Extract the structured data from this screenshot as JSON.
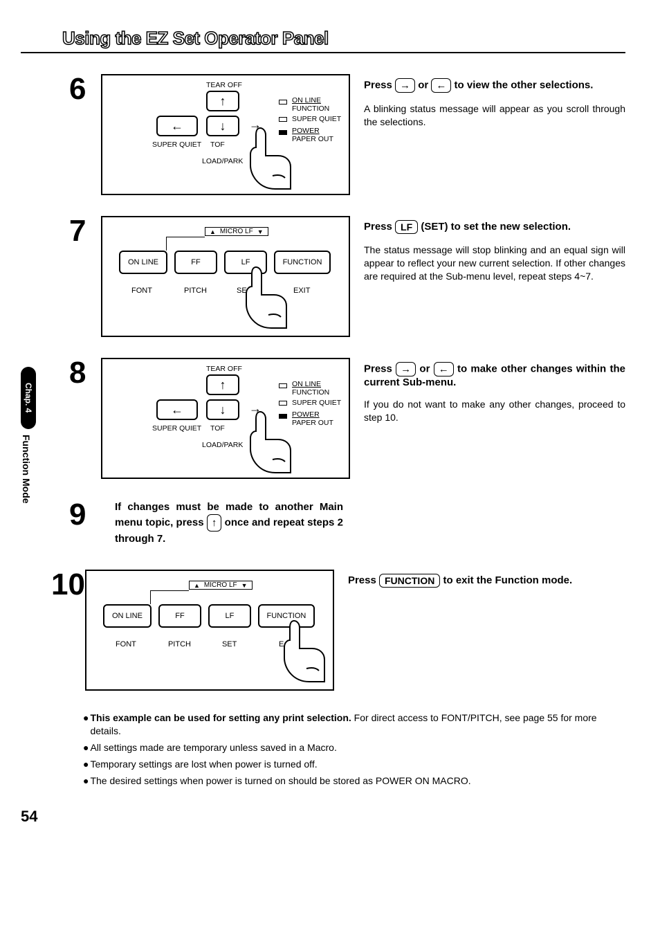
{
  "title": "Using the EZ Set Operator Panel",
  "side_tab": {
    "chapter": "Chap. 4",
    "label": "Function Mode"
  },
  "steps": {
    "s6": {
      "num": "6",
      "intro_pre": "Press ",
      "intro_mid": " or ",
      "intro_post": " to view the other selections.",
      "arrow_r": "→",
      "arrow_l": "←",
      "explain": "A blinking status message will appear as you scroll through the selections."
    },
    "s7": {
      "num": "7",
      "intro_pre": "Press ",
      "intro_key": "LF",
      "intro_mid": " (SET) to set the new selection.",
      "explain": "The status message will stop blinking and an equal sign will appear to reflect your new current selection. If other changes are required at the Sub-menu level, repeat steps 4~7."
    },
    "s8": {
      "num": "8",
      "intro_pre": "Press ",
      "intro_mid": " or ",
      "intro_post": " to make other changes within the current Sub-menu.",
      "arrow_r": "→",
      "arrow_l": "←",
      "explain": "If you do not want to make any other changes, proceed to step 10."
    },
    "s9": {
      "num": "9",
      "text_pre": "If changes must be made to another Main menu topic, press ",
      "key": "↑",
      "text_post": " once and repeat steps 2 through 7."
    },
    "s10": {
      "num": "10",
      "intro_pre": "Press ",
      "intro_key": "FUNCTION",
      "intro_post": " to exit the Function mode."
    }
  },
  "panelA": {
    "tearoff": "TEAR OFF",
    "superquiet": "SUPER QUIET",
    "loadpark": "LOAD/PARK",
    "tof": "TOF",
    "leds": {
      "online": "ON LINE",
      "function": "FUNCTION",
      "superquiet": "SUPER QUIET",
      "power": "POWER",
      "paperout": "PAPER OUT"
    }
  },
  "panelB": {
    "micro_label": "MICRO LF",
    "btn1": "ON LINE",
    "btn2": "FF",
    "btn3": "LF",
    "btn4": "FUNCTION",
    "lbl1": "FONT",
    "lbl2": "PITCH",
    "lbl3": "SET",
    "lbl4": "EXIT",
    "lbl3_10": "SET",
    "lbl4_10": "EXIT",
    "se_partial": "SE",
    "ex_partial": "E"
  },
  "notes": {
    "n1_bold": "This example can be used for setting any print selection.",
    "n1_rest": " For direct access to FONT/PITCH, see page 55 for more details.",
    "n2": "All settings made are temporary unless saved in a Macro.",
    "n3": "Temporary settings are lost when power is turned off.",
    "n4": "The desired settings when power is turned on should be stored as POWER ON MACRO."
  },
  "page_number": "54"
}
